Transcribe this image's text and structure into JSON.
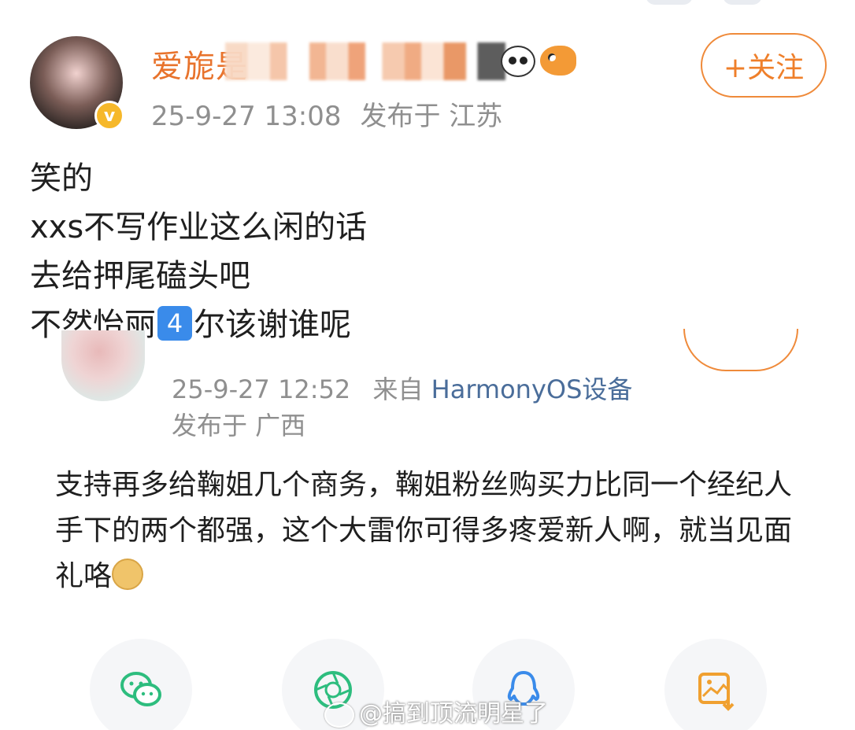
{
  "post": {
    "username_visible": "爱旎是",
    "follow_label": "+关注",
    "timestamp": "25-9-27 13:08",
    "location": "发布于 江苏",
    "body_lines": [
      "笑的",
      "xxs不写作业这么闲的话",
      "去给押尾磕头吧"
    ],
    "last_line_before": "不然怡丽",
    "keycap_digit": "4",
    "last_line_after": "尔该谢谁呢",
    "verified_badge": "v"
  },
  "comment": {
    "timestamp": "25-9-27 12:52",
    "source_prefix": "来自",
    "device": "HarmonyOS设备",
    "location": "发布于 广西",
    "body": "支持再多给鞠姐几个商务，鞠姐粉丝购买力比同一个经纪人手下的两个都强，这个大雷你可得多疼爱新人啊，就当见面礼咯"
  },
  "share_bar": {
    "icons": [
      "wechat-icon",
      "moments-icon",
      "qq-icon",
      "save-image-icon"
    ]
  },
  "watermark": "@搞到顶流明星了",
  "colors": {
    "accent": "#ef7f2a",
    "meta_gray": "#8f8f8f",
    "device_blue": "#4a6d9a",
    "share_green": "#2dbd7e",
    "share_blue": "#3a8bea",
    "share_orange": "#f0a030"
  }
}
